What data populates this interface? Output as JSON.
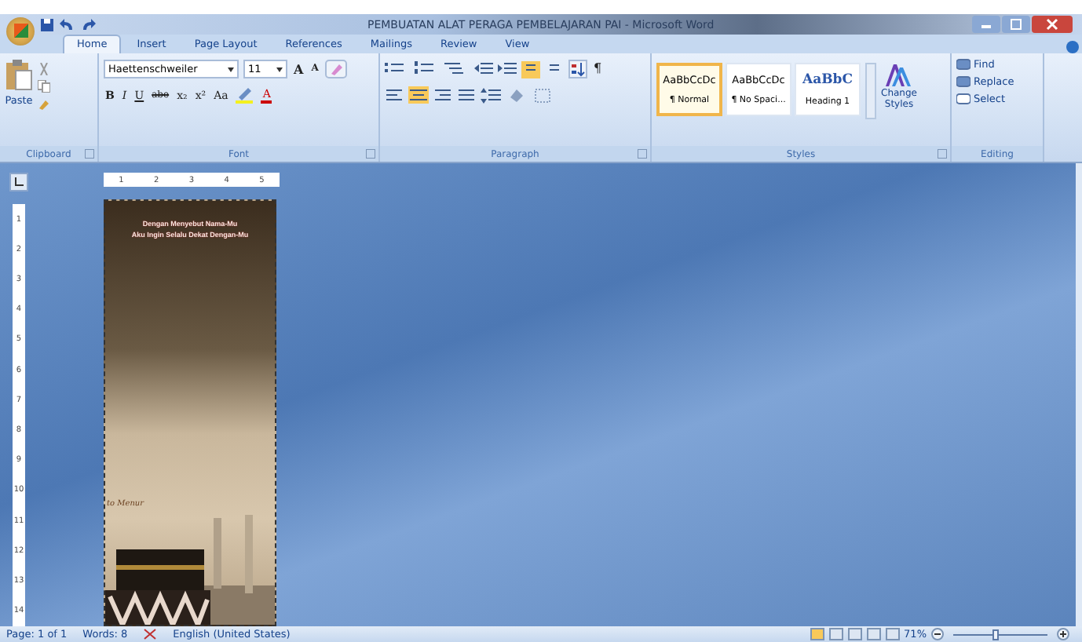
{
  "window": {
    "title": "PEMBUATAN ALAT PERAGA PEMBELAJARAN PAI - Microsoft Word"
  },
  "tabs": [
    {
      "label": "Home",
      "selected": true
    },
    {
      "label": "Insert",
      "selected": false
    },
    {
      "label": "Page Layout",
      "selected": false
    },
    {
      "label": "References",
      "selected": false
    },
    {
      "label": "Mailings",
      "selected": false
    },
    {
      "label": "Review",
      "selected": false
    },
    {
      "label": "View",
      "selected": false
    }
  ],
  "ribbon": {
    "clipboard": {
      "paste": "Paste",
      "label": "Clipboard"
    },
    "font": {
      "name": "Haettenschweiler",
      "size": "11",
      "buttons": [
        "B",
        "I",
        "U",
        "abe",
        "x₂",
        "x²",
        "Aa"
      ],
      "grow": "A",
      "shrink": "A",
      "color_button": "A",
      "label": "Font"
    },
    "paragraph": {
      "marks_button": "¶",
      "label": "Paragraph"
    },
    "styles": {
      "items": [
        {
          "sample": "AaBbCcDc",
          "name": "¶ Normal",
          "kind": "plain",
          "selected": true
        },
        {
          "sample": "AaBbCcDc",
          "name": "¶ No Spaci...",
          "kind": "plain",
          "selected": false
        },
        {
          "sample": "AaBbC",
          "name": "Heading 1",
          "kind": "heading",
          "selected": false
        }
      ],
      "change": [
        "Change",
        "Styles"
      ],
      "label": "Styles"
    },
    "editing": {
      "items": [
        "Find",
        "Replace",
        "Select"
      ],
      "label": "Editing"
    }
  },
  "ruler": {
    "horizontal": [
      "1",
      "2",
      "3",
      "4",
      "5"
    ],
    "vertical": [
      "1",
      "2",
      "3",
      "4",
      "5",
      "6",
      "7",
      "8",
      "9",
      "10",
      "11",
      "12",
      "13",
      "14"
    ]
  },
  "document": {
    "lines": [
      "Dengan Menyebut Nama-Mu",
      "Aku Ingin Selalu Dekat Dengan-Mu"
    ],
    "caption": "to Menur"
  },
  "status_bar": {
    "page": "Page: 1 of 1",
    "words": "Words: 8",
    "language": "English (United States)",
    "zoom": "71%",
    "zoom_slider": {
      "level": 0.45
    }
  }
}
